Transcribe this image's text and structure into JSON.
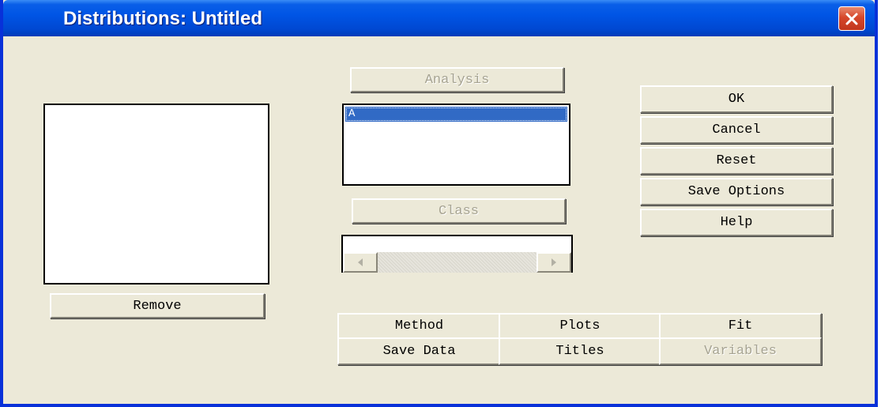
{
  "window": {
    "title": "Distributions: Untitled",
    "close_icon": "close-icon"
  },
  "buttons": {
    "analysis": "Analysis",
    "class": "Class",
    "ok": "OK",
    "cancel": "Cancel",
    "reset": "Reset",
    "save_options": "Save Options",
    "help": "Help",
    "remove": "Remove"
  },
  "variables_list": {
    "items": [
      "A"
    ],
    "selected_index": 0
  },
  "tabs": {
    "method": "Method",
    "plots": "Plots",
    "fit": "Fit",
    "save_data": "Save Data",
    "titles": "Titles",
    "variables": "Variables"
  },
  "colors": {
    "titlebar": "#0055e5",
    "dialog_bg": "#ece9d8",
    "selection": "#316ac5",
    "close_button": "#d6472a"
  }
}
